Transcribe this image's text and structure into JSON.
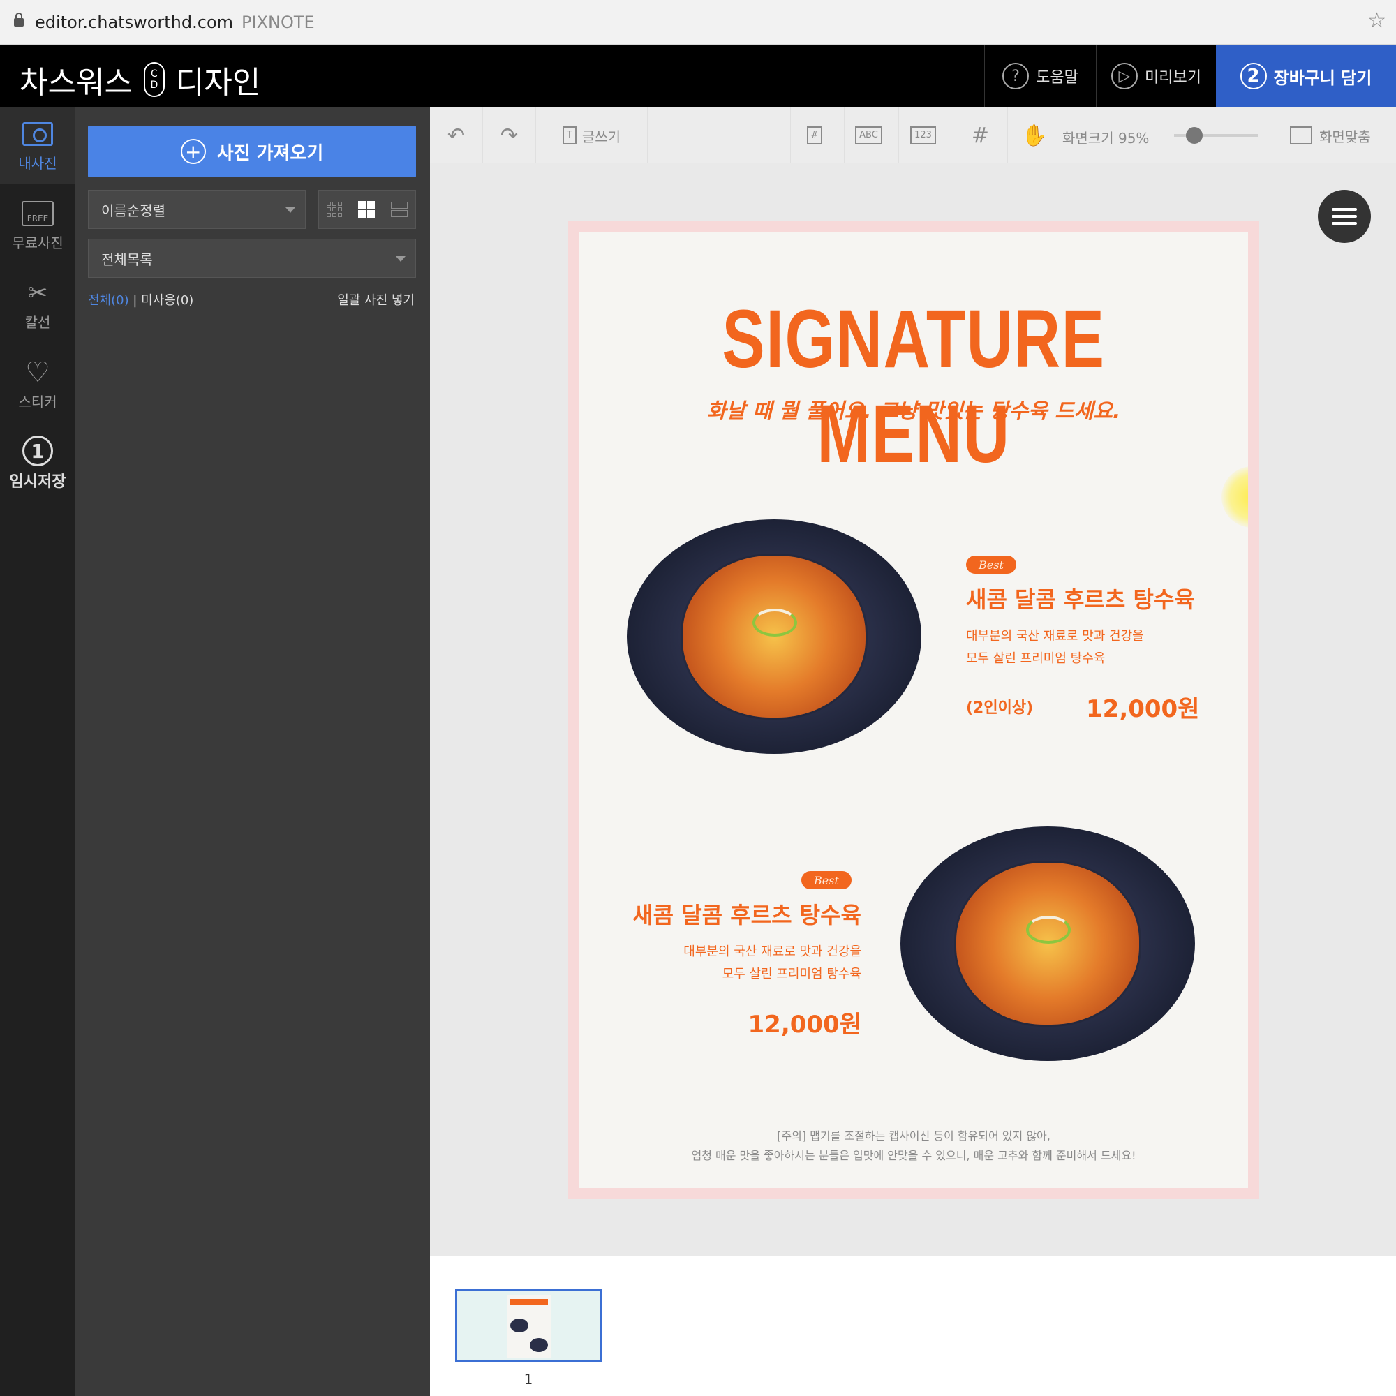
{
  "browser": {
    "url": "editor.chatsworthd.com",
    "brand": "PIXNOTE"
  },
  "header": {
    "logo_left": "차스워스",
    "logo_mark_top": "C",
    "logo_mark_bottom": "D",
    "logo_right": "디자인",
    "help_label": "도움말",
    "help_icon": "?",
    "preview_label": "미리보기",
    "preview_icon": "▷",
    "cart_step": "2",
    "cart_label": "장바구니 담기",
    "accent_color": "#2f5fc7"
  },
  "sidebar": {
    "items": [
      {
        "label": "내사진",
        "icon": "photo-icon",
        "active": true
      },
      {
        "label": "무료사진",
        "icon": "free-photo-icon",
        "glyph": "FREE"
      },
      {
        "label": "칼선",
        "icon": "scissors-icon",
        "glyph": "✂"
      },
      {
        "label": "스티커",
        "icon": "heart-icon",
        "glyph": "♡"
      },
      {
        "label": "임시저장",
        "icon": "step-one-icon",
        "glyph": "1"
      }
    ]
  },
  "panel": {
    "import_label": "사진 가져오기",
    "sort_value": "이름순정렬",
    "list_value": "전체목록",
    "filter_all": "전체(0)",
    "filter_sep": " | ",
    "filter_unused": "미사용(0)",
    "bulk_insert": "일괄 사진 넣기"
  },
  "toolbar": {
    "text_tool": "글쓰기",
    "text_icon": "T",
    "hash_icon": "#",
    "abc_icon": "ABC",
    "num_icon": "123",
    "grid_icon": "#",
    "zoom_label": "화면크기",
    "zoom_value": "95%",
    "zoom_level": 0.24,
    "fit_label": "화면맞춤"
  },
  "poster": {
    "title": "SIGNATURE MENU",
    "subtitle": "화날 때 뭘 풀어요. 그냥 맛있는 탕수육 드세요.",
    "accent_color": "#f2661e",
    "items": [
      {
        "badge": "Best",
        "name": "새콤 달콤 후르츠 탕수육",
        "desc_line1": "대부분의 국산 재료로 맛과 건강을",
        "desc_line2": "모두 살린 프리미엄 탕수육",
        "pax": "(2인이상)",
        "price": "12,000원"
      },
      {
        "badge": "Best",
        "name": "새콤 달콤 후르츠 탕수육",
        "desc_line1": "대부분의 국산 재료로 맛과 건강을",
        "desc_line2": "모두 살린 프리미엄 탕수육",
        "price": "12,000원"
      }
    ],
    "note_line1": "[주의] 맵기를 조절하는 캡사이신 등이 함유되어 있지 않아,",
    "note_line2": "엄청 매운 맛을 좋아하시는 분들은 입맛에 안맞을 수 있으니, 매운 고추와 함께 준비해서 드세요!"
  },
  "pages": {
    "thumb_number": "1"
  }
}
